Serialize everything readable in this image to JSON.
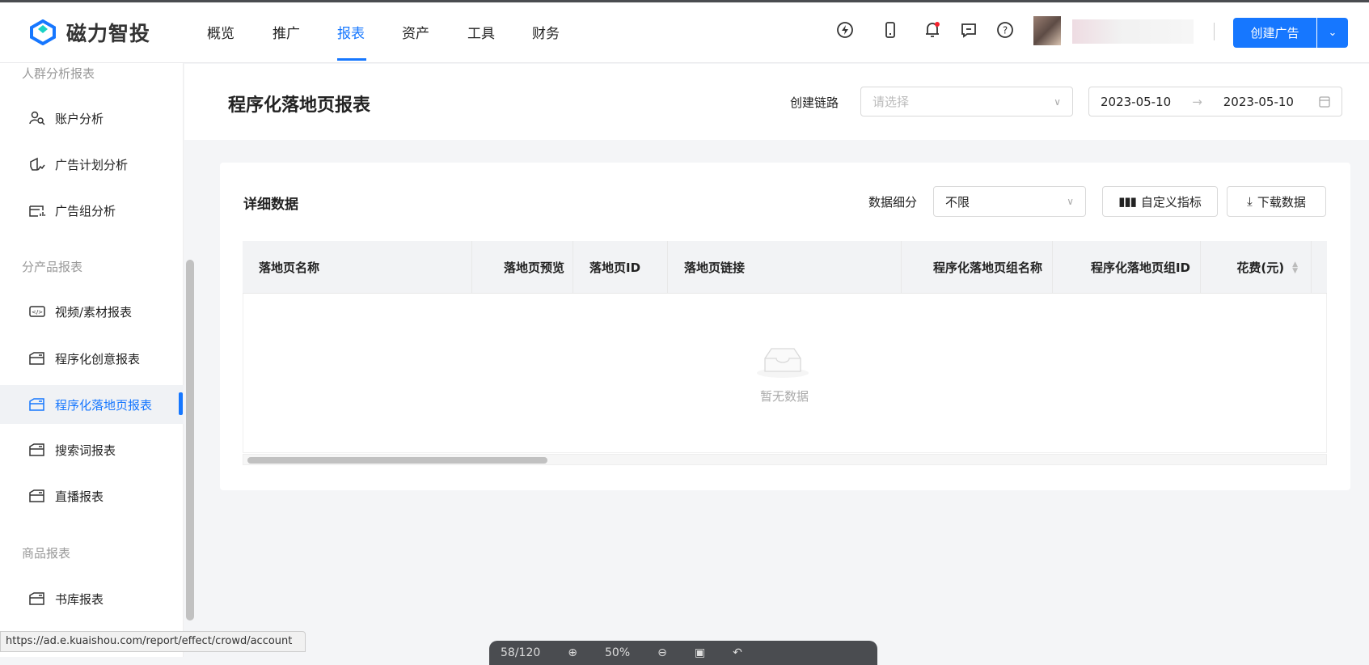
{
  "header": {
    "logo": "磁力智投",
    "nav": [
      "概览",
      "推广",
      "报表",
      "资产",
      "工具",
      "财务"
    ],
    "active_nav": "报表",
    "create_btn": "创建广告"
  },
  "sidebar": {
    "sections": [
      {
        "title": "人群分析报表",
        "items": [
          "账户分析",
          "广告计划分析",
          "广告组分析"
        ]
      },
      {
        "title": "分产品报表",
        "items": [
          "视频/素材报表",
          "程序化创意报表",
          "程序化落地页报表",
          "搜索词报表",
          "直播报表"
        ]
      },
      {
        "title": "商品报表",
        "items": [
          "书库报表"
        ]
      }
    ],
    "active": "程序化落地页报表"
  },
  "content": {
    "title": "程序化落地页报表",
    "chain_label": "创建链路",
    "chain_placeholder": "请选择",
    "date_start": "2023-05-10",
    "date_end": "2023-05-10"
  },
  "card": {
    "title": "详细数据",
    "breakdown_label": "数据细分",
    "breakdown_value": "不限",
    "custom_btn": "自定义指标",
    "download_btn": "下载数据",
    "columns": [
      "落地页名称",
      "落地页预览",
      "落地页ID",
      "落地页链接",
      "程序化落地页组名称",
      "程序化落地页组ID",
      "花费(元)"
    ],
    "empty": "暂无数据"
  },
  "status_url": "https://ad.e.kuaishou.com/report/effect/crowd/account",
  "viewer": {
    "page": "58/120",
    "zoom": "50%"
  },
  "colors": {
    "accent": "#1677ff"
  }
}
